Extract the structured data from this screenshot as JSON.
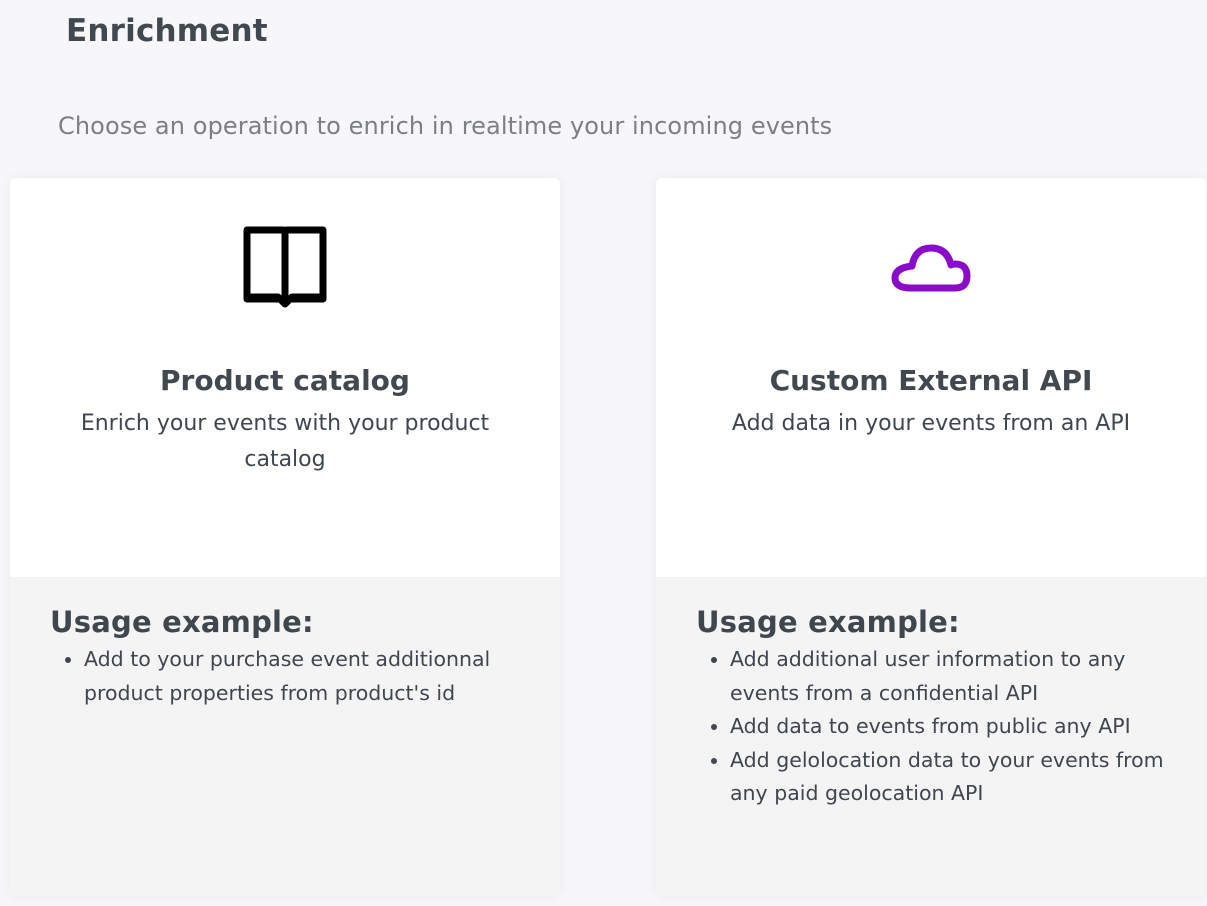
{
  "page": {
    "title": "Enrichment",
    "subtitle": "Choose an operation to enrich in realtime your incoming events"
  },
  "cards": [
    {
      "icon": "book-open-icon",
      "icon_color": "#000000",
      "title": "Product catalog",
      "description": "Enrich your events with your product catalog",
      "usage_title": "Usage example:",
      "usage_items": [
        "Add to your purchase event additionnal product properties from product's id"
      ]
    },
    {
      "icon": "cloud-icon",
      "icon_color": "#8a0cc8",
      "title": "Custom External API",
      "description": "Add data in your events from an API",
      "usage_title": "Usage example:",
      "usage_items": [
        "Add additional user information to any events from a confidential API",
        "Add data to events from public any API",
        "Add gelolocation data to your events from any paid geolocation API"
      ]
    }
  ]
}
